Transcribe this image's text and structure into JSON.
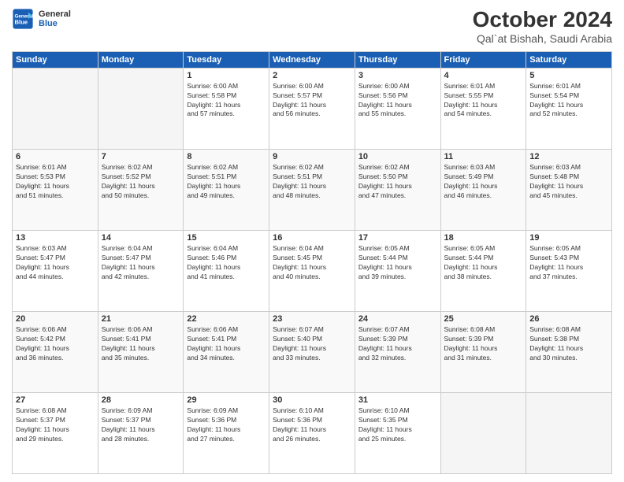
{
  "header": {
    "logo_line1": "General",
    "logo_line2": "Blue",
    "month": "October 2024",
    "location": "Qal`at Bishah, Saudi Arabia"
  },
  "weekdays": [
    "Sunday",
    "Monday",
    "Tuesday",
    "Wednesday",
    "Thursday",
    "Friday",
    "Saturday"
  ],
  "weeks": [
    [
      {
        "day": "",
        "sunrise": "",
        "sunset": "",
        "daylight": ""
      },
      {
        "day": "",
        "sunrise": "",
        "sunset": "",
        "daylight": ""
      },
      {
        "day": "1",
        "sunrise": "Sunrise: 6:00 AM",
        "sunset": "Sunset: 5:58 PM",
        "daylight": "Daylight: 11 hours and 57 minutes."
      },
      {
        "day": "2",
        "sunrise": "Sunrise: 6:00 AM",
        "sunset": "Sunset: 5:57 PM",
        "daylight": "Daylight: 11 hours and 56 minutes."
      },
      {
        "day": "3",
        "sunrise": "Sunrise: 6:00 AM",
        "sunset": "Sunset: 5:56 PM",
        "daylight": "Daylight: 11 hours and 55 minutes."
      },
      {
        "day": "4",
        "sunrise": "Sunrise: 6:01 AM",
        "sunset": "Sunset: 5:55 PM",
        "daylight": "Daylight: 11 hours and 54 minutes."
      },
      {
        "day": "5",
        "sunrise": "Sunrise: 6:01 AM",
        "sunset": "Sunset: 5:54 PM",
        "daylight": "Daylight: 11 hours and 52 minutes."
      }
    ],
    [
      {
        "day": "6",
        "sunrise": "Sunrise: 6:01 AM",
        "sunset": "Sunset: 5:53 PM",
        "daylight": "Daylight: 11 hours and 51 minutes."
      },
      {
        "day": "7",
        "sunrise": "Sunrise: 6:02 AM",
        "sunset": "Sunset: 5:52 PM",
        "daylight": "Daylight: 11 hours and 50 minutes."
      },
      {
        "day": "8",
        "sunrise": "Sunrise: 6:02 AM",
        "sunset": "Sunset: 5:51 PM",
        "daylight": "Daylight: 11 hours and 49 minutes."
      },
      {
        "day": "9",
        "sunrise": "Sunrise: 6:02 AM",
        "sunset": "Sunset: 5:51 PM",
        "daylight": "Daylight: 11 hours and 48 minutes."
      },
      {
        "day": "10",
        "sunrise": "Sunrise: 6:02 AM",
        "sunset": "Sunset: 5:50 PM",
        "daylight": "Daylight: 11 hours and 47 minutes."
      },
      {
        "day": "11",
        "sunrise": "Sunrise: 6:03 AM",
        "sunset": "Sunset: 5:49 PM",
        "daylight": "Daylight: 11 hours and 46 minutes."
      },
      {
        "day": "12",
        "sunrise": "Sunrise: 6:03 AM",
        "sunset": "Sunset: 5:48 PM",
        "daylight": "Daylight: 11 hours and 45 minutes."
      }
    ],
    [
      {
        "day": "13",
        "sunrise": "Sunrise: 6:03 AM",
        "sunset": "Sunset: 5:47 PM",
        "daylight": "Daylight: 11 hours and 44 minutes."
      },
      {
        "day": "14",
        "sunrise": "Sunrise: 6:04 AM",
        "sunset": "Sunset: 5:47 PM",
        "daylight": "Daylight: 11 hours and 42 minutes."
      },
      {
        "day": "15",
        "sunrise": "Sunrise: 6:04 AM",
        "sunset": "Sunset: 5:46 PM",
        "daylight": "Daylight: 11 hours and 41 minutes."
      },
      {
        "day": "16",
        "sunrise": "Sunrise: 6:04 AM",
        "sunset": "Sunset: 5:45 PM",
        "daylight": "Daylight: 11 hours and 40 minutes."
      },
      {
        "day": "17",
        "sunrise": "Sunrise: 6:05 AM",
        "sunset": "Sunset: 5:44 PM",
        "daylight": "Daylight: 11 hours and 39 minutes."
      },
      {
        "day": "18",
        "sunrise": "Sunrise: 6:05 AM",
        "sunset": "Sunset: 5:44 PM",
        "daylight": "Daylight: 11 hours and 38 minutes."
      },
      {
        "day": "19",
        "sunrise": "Sunrise: 6:05 AM",
        "sunset": "Sunset: 5:43 PM",
        "daylight": "Daylight: 11 hours and 37 minutes."
      }
    ],
    [
      {
        "day": "20",
        "sunrise": "Sunrise: 6:06 AM",
        "sunset": "Sunset: 5:42 PM",
        "daylight": "Daylight: 11 hours and 36 minutes."
      },
      {
        "day": "21",
        "sunrise": "Sunrise: 6:06 AM",
        "sunset": "Sunset: 5:41 PM",
        "daylight": "Daylight: 11 hours and 35 minutes."
      },
      {
        "day": "22",
        "sunrise": "Sunrise: 6:06 AM",
        "sunset": "Sunset: 5:41 PM",
        "daylight": "Daylight: 11 hours and 34 minutes."
      },
      {
        "day": "23",
        "sunrise": "Sunrise: 6:07 AM",
        "sunset": "Sunset: 5:40 PM",
        "daylight": "Daylight: 11 hours and 33 minutes."
      },
      {
        "day": "24",
        "sunrise": "Sunrise: 6:07 AM",
        "sunset": "Sunset: 5:39 PM",
        "daylight": "Daylight: 11 hours and 32 minutes."
      },
      {
        "day": "25",
        "sunrise": "Sunrise: 6:08 AM",
        "sunset": "Sunset: 5:39 PM",
        "daylight": "Daylight: 11 hours and 31 minutes."
      },
      {
        "day": "26",
        "sunrise": "Sunrise: 6:08 AM",
        "sunset": "Sunset: 5:38 PM",
        "daylight": "Daylight: 11 hours and 30 minutes."
      }
    ],
    [
      {
        "day": "27",
        "sunrise": "Sunrise: 6:08 AM",
        "sunset": "Sunset: 5:37 PM",
        "daylight": "Daylight: 11 hours and 29 minutes."
      },
      {
        "day": "28",
        "sunrise": "Sunrise: 6:09 AM",
        "sunset": "Sunset: 5:37 PM",
        "daylight": "Daylight: 11 hours and 28 minutes."
      },
      {
        "day": "29",
        "sunrise": "Sunrise: 6:09 AM",
        "sunset": "Sunset: 5:36 PM",
        "daylight": "Daylight: 11 hours and 27 minutes."
      },
      {
        "day": "30",
        "sunrise": "Sunrise: 6:10 AM",
        "sunset": "Sunset: 5:36 PM",
        "daylight": "Daylight: 11 hours and 26 minutes."
      },
      {
        "day": "31",
        "sunrise": "Sunrise: 6:10 AM",
        "sunset": "Sunset: 5:35 PM",
        "daylight": "Daylight: 11 hours and 25 minutes."
      },
      {
        "day": "",
        "sunrise": "",
        "sunset": "",
        "daylight": ""
      },
      {
        "day": "",
        "sunrise": "",
        "sunset": "",
        "daylight": ""
      }
    ]
  ]
}
